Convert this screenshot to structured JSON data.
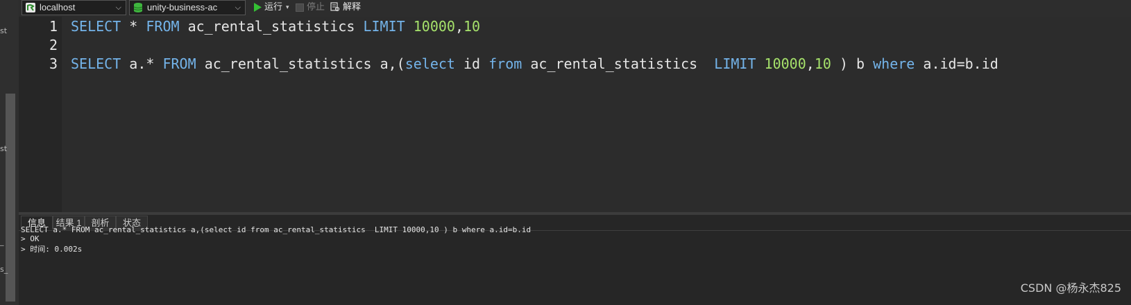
{
  "toolbar": {
    "connection": "localhost",
    "database": "unity-business-ac",
    "run_label": "运行",
    "stop_label": "停止",
    "explain_label": "解释"
  },
  "left_fragments": [
    "st",
    "st",
    "_",
    "s_"
  ],
  "editor": {
    "line_numbers": [
      "1",
      "2",
      "3"
    ],
    "lines": [
      "SELECT * FROM ac_rental_statistics LIMIT 10000,10",
      "",
      "SELECT a.* FROM ac_rental_statistics a,(select id from ac_rental_statistics  LIMIT 10000,10 ) b where a.id=b.id"
    ]
  },
  "result_panel": {
    "tabs": [
      "信息",
      "结果 1",
      "剖析",
      "状态"
    ],
    "active_tab": "信息",
    "messages": [
      "SELECT a.* FROM ac_rental_statistics a,(select id from ac_rental_statistics  LIMIT 10000,10 ) b where a.id=b.id",
      "> OK",
      "> 时间: 0.002s"
    ]
  },
  "watermark": "CSDN @杨永杰825",
  "colors": {
    "keyword": "#74b4ea",
    "number": "#a6e26b",
    "run_green": "#34c034"
  }
}
